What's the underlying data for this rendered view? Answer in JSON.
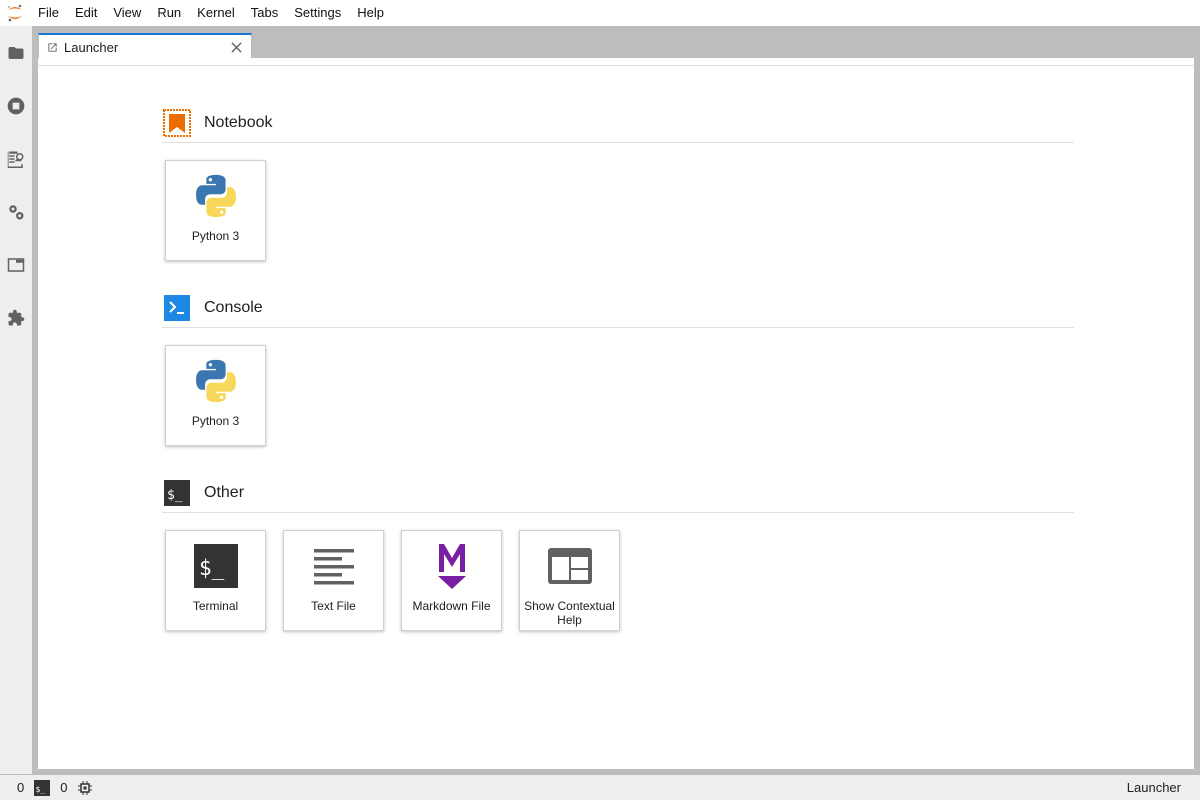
{
  "menubar": {
    "items": [
      "File",
      "Edit",
      "View",
      "Run",
      "Kernel",
      "Tabs",
      "Settings",
      "Help"
    ]
  },
  "sidebar": {
    "icons": [
      "folder-icon",
      "running-icon",
      "property-inspector-icon",
      "settings-icon",
      "tabs-icon",
      "extension-icon"
    ]
  },
  "tab": {
    "label": "Launcher"
  },
  "launcher": {
    "sections": [
      {
        "title": "Notebook",
        "cards": [
          {
            "label": "Python 3"
          }
        ]
      },
      {
        "title": "Console",
        "cards": [
          {
            "label": "Python 3"
          }
        ]
      },
      {
        "title": "Other",
        "cards": [
          {
            "label": "Terminal"
          },
          {
            "label": "Text File"
          },
          {
            "label": "Markdown File"
          },
          {
            "label": "Show Contextual Help"
          }
        ]
      }
    ]
  },
  "statusbar": {
    "kernels_count": "0",
    "terminals_count": "0",
    "right_label": "Launcher"
  },
  "colors": {
    "accent": "#1976d2",
    "notebook": "#ef6c00",
    "console": "#1e88e5",
    "markdown": "#7b1fa2",
    "icon_gray": "#616161"
  }
}
